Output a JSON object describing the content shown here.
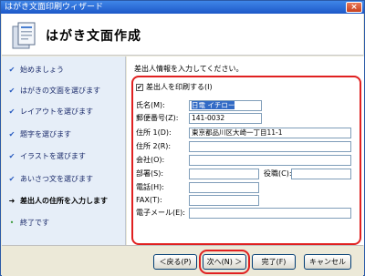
{
  "window": {
    "title": "はがき文面印刷ウィザード",
    "close_label": "×"
  },
  "header": {
    "heading": "はがき文面作成"
  },
  "nav": {
    "items": [
      {
        "label": "始めましょう",
        "state": "done",
        "mark": "✔"
      },
      {
        "label": "はがきの文面を選びます",
        "state": "done",
        "mark": "✔"
      },
      {
        "label": "レイアウトを選びます",
        "state": "done",
        "mark": "✔"
      },
      {
        "label": "題字を選びます",
        "state": "done",
        "mark": "✔"
      },
      {
        "label": "イラストを選びます",
        "state": "done",
        "mark": "✔"
      },
      {
        "label": "あいさつ文を選びます",
        "state": "done",
        "mark": "✔"
      },
      {
        "label": "差出人の住所を入力します",
        "state": "current",
        "mark": "➜"
      },
      {
        "label": "終了です",
        "state": "pending",
        "mark": "•"
      }
    ]
  },
  "form": {
    "instruction": "差出人情報を入力してください。",
    "print_sender_checkbox": {
      "label": "差出人を印刷する(I)",
      "checked": true,
      "check_glyph": "✔"
    },
    "fields": {
      "name": {
        "label": "氏名(M):",
        "value": "日電 イチロー"
      },
      "postal": {
        "label": "郵便番号(Z):",
        "value": "141-0032"
      },
      "address1": {
        "label": "住所 1(D):",
        "value": "東京都品川区大崎一丁目11-1"
      },
      "address2": {
        "label": "住所 2(R):",
        "value": ""
      },
      "company": {
        "label": "会社(O):",
        "value": ""
      },
      "department": {
        "label": "部署(S):",
        "value": ""
      },
      "position": {
        "label": "役職(C):",
        "value": ""
      },
      "phone": {
        "label": "電話(H):",
        "value": ""
      },
      "fax": {
        "label": "FAX(T):",
        "value": ""
      },
      "email": {
        "label": "電子メール(E):",
        "value": ""
      }
    }
  },
  "footer": {
    "back_label": "＜戻る(P)",
    "next_label": "次へ(N) ＞",
    "finish_label": "完了(F)",
    "cancel_label": "キャンセル"
  },
  "colors": {
    "highlight_frame": "#e02020",
    "title_bar": "#1d58c8",
    "nav_background": "#e6eef8"
  }
}
